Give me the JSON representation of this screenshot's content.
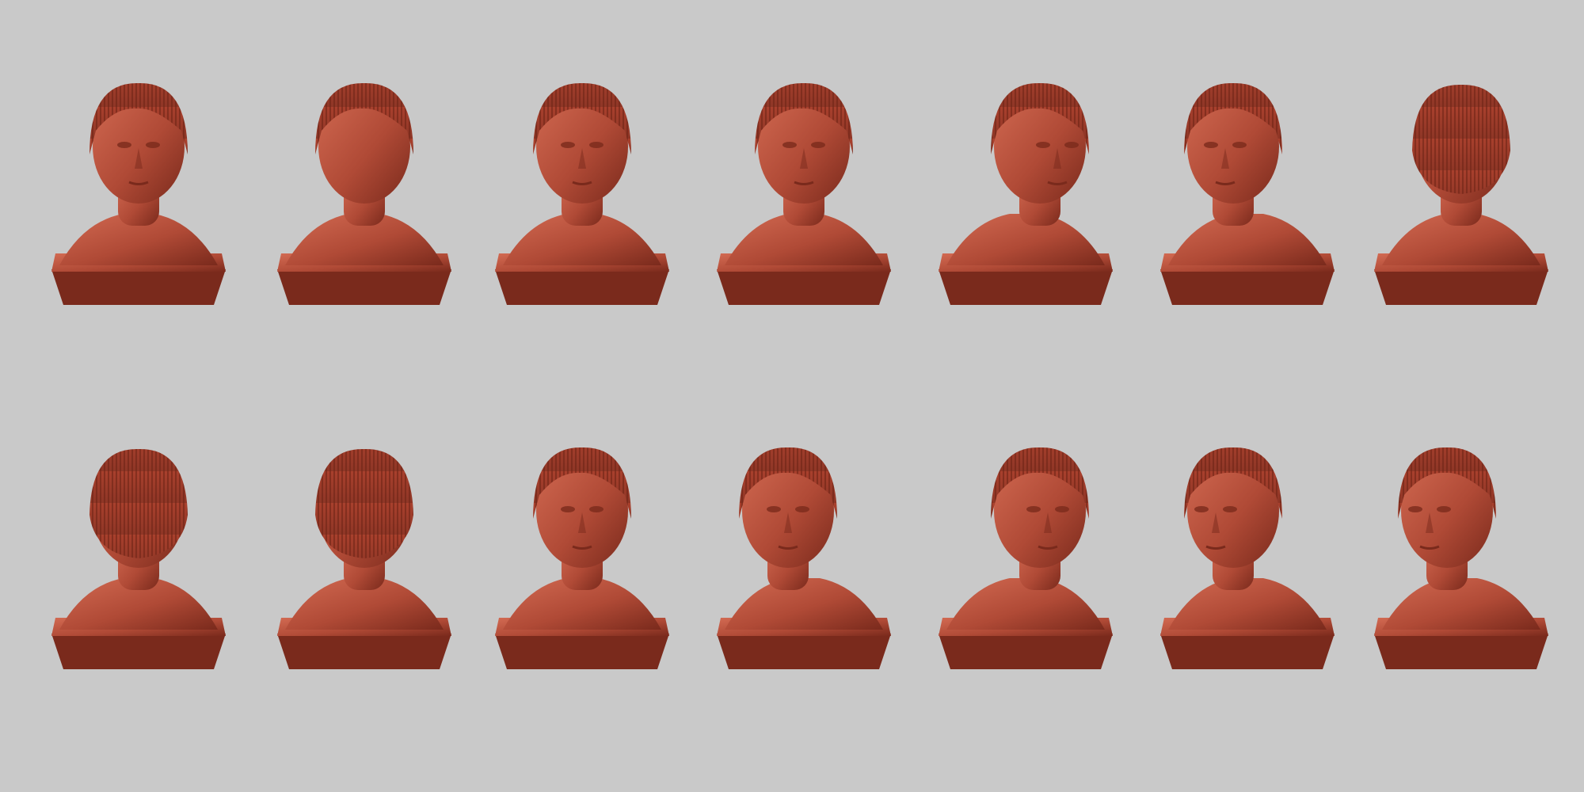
{
  "scene": {
    "background_color": "#c9c9c9",
    "clay_color": "#b04a36",
    "clay_shadow": "#7a2a1c",
    "clay_highlight": "#d26a52",
    "hair_color": "#8e3626",
    "rows": [
      {
        "busts": [
          {
            "view": "front"
          },
          {
            "view": "top-back-tilt"
          },
          {
            "view": "front"
          },
          {
            "view": "front"
          },
          {
            "view": "right-profile"
          },
          {
            "view": "left-three-quarter"
          },
          {
            "view": "back-right"
          }
        ]
      },
      {
        "busts": [
          {
            "view": "back-left"
          },
          {
            "view": "back"
          },
          {
            "view": "front-down"
          },
          {
            "view": "tilted-down-left"
          },
          {
            "view": "right-three-quarter"
          },
          {
            "view": "back-left-profile"
          },
          {
            "view": "left-profile"
          }
        ]
      }
    ]
  }
}
